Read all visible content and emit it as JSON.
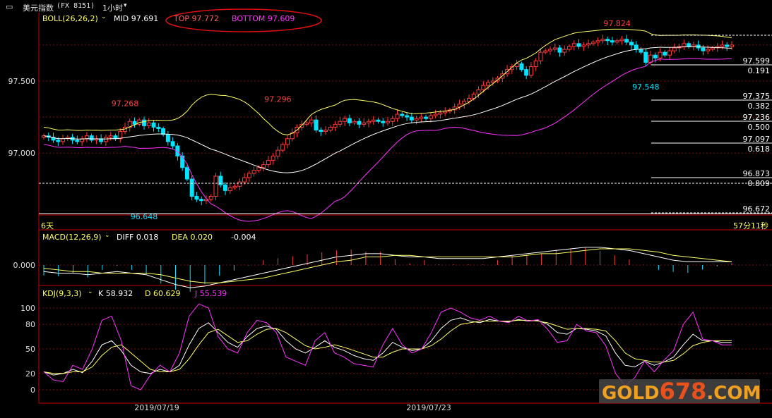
{
  "window": {
    "title": "美元指数",
    "code": "(FX 8151)",
    "period": "1小时"
  },
  "indicators": {
    "boll": {
      "name": "BOLL(26,26,2)",
      "mid_label": "MID",
      "mid": "97.691",
      "top_label": "TOP",
      "top": "97.772",
      "bottom_label": "BOTTOM",
      "bottom": "97.609"
    },
    "macd": {
      "name": "MACD(12,26,9)",
      "diff_label": "DIFF",
      "diff": "0.018",
      "dea_label": "DEA",
      "dea": "0.020",
      "macd": "-0.004"
    },
    "kdj": {
      "name": "KDJ(9,3,3)",
      "k_label": "K",
      "k": "58.932",
      "d_label": "D",
      "d": "60.629",
      "j_label": "J",
      "j": "55.539"
    }
  },
  "status": {
    "days": "6天",
    "countdown": "57分11秒"
  },
  "watermark": {
    "part1": "GOLD",
    "part2": "678",
    "part3": ".COM"
  },
  "colors": {
    "up": "#ff3c3c",
    "down": "#00e5ff",
    "top": "#ffff66",
    "mid": "#ffffff",
    "bottom": "#ff33ff",
    "grid": "#7a1010",
    "axis": "#cc0000",
    "annot_high": "#ff4040",
    "annot_low": "#00e5ff"
  },
  "chart_data": [
    {
      "type": "candlestick",
      "title": "美元指数 1小时",
      "y_ticks": [
        97.5,
        97.0
      ],
      "y_tick_labels": [
        "97.500",
        "97.000"
      ],
      "x_tick_labels": [
        "2019/07/19",
        "2019/07/23"
      ],
      "ylim": [
        96.6,
        97.95
      ],
      "annotations": [
        {
          "text": "97.268",
          "value": 97.268,
          "kind": "high",
          "index": 17
        },
        {
          "text": "96.648",
          "value": 96.648,
          "kind": "low",
          "index": 21
        },
        {
          "text": "97.296",
          "value": 97.296,
          "kind": "high",
          "index": 49
        },
        {
          "text": "97.824",
          "value": 97.824,
          "kind": "high",
          "index": 120
        },
        {
          "text": "97.548",
          "value": 97.548,
          "kind": "low",
          "index": 126
        }
      ],
      "fib_levels": [
        {
          "price": "97.599",
          "ratio": "0.191"
        },
        {
          "price": "97.375",
          "ratio": "0.382"
        },
        {
          "price": "97.236",
          "ratio": "0.500"
        },
        {
          "price": "97.097",
          "ratio": "0.618"
        },
        {
          "price": "96.873",
          "ratio": "0.809"
        },
        {
          "price": "96.672",
          "ratio": ""
        }
      ],
      "series_close": [
        97.12,
        97.11,
        97.09,
        97.08,
        97.1,
        97.11,
        97.09,
        97.08,
        97.1,
        97.12,
        97.09,
        97.1,
        97.08,
        97.11,
        97.12,
        97.1,
        97.15,
        97.18,
        97.22,
        97.2,
        97.23,
        97.19,
        97.21,
        97.18,
        97.17,
        97.13,
        97.08,
        97.05,
        96.98,
        96.9,
        96.82,
        96.7,
        96.68,
        96.67,
        96.68,
        96.7,
        96.84,
        96.78,
        96.74,
        96.76,
        96.77,
        96.8,
        96.83,
        96.86,
        96.88,
        96.9,
        96.92,
        96.95,
        96.98,
        97.02,
        97.06,
        97.1,
        97.14,
        97.18,
        97.2,
        97.21,
        97.23,
        97.16,
        97.15,
        97.16,
        97.18,
        97.2,
        97.22,
        97.24,
        97.21,
        97.22,
        97.2,
        97.21,
        97.22,
        97.23,
        97.22,
        97.21,
        97.22,
        97.24,
        97.27,
        97.26,
        97.25,
        97.23,
        97.24,
        97.25,
        97.24,
        97.26,
        97.27,
        97.28,
        97.29,
        97.3,
        97.32,
        97.34,
        97.36,
        97.38,
        97.41,
        97.44,
        97.47,
        97.49,
        97.5,
        97.52,
        97.55,
        97.58,
        97.6,
        97.62,
        97.58,
        97.54,
        97.6,
        97.64,
        97.7,
        97.71,
        97.72,
        97.73,
        97.7,
        97.72,
        97.74,
        97.76,
        97.74,
        97.75,
        97.76,
        97.77,
        97.78,
        97.79,
        97.78,
        97.77,
        97.78,
        97.79,
        97.77,
        97.75,
        97.72,
        97.7,
        97.63,
        97.68,
        97.66,
        97.7,
        97.68,
        97.71,
        97.73,
        97.74,
        97.76,
        97.74,
        97.75,
        97.73,
        97.71,
        97.72,
        97.73,
        97.74,
        97.75,
        97.74,
        97.75
      ]
    },
    {
      "type": "line",
      "title": "MACD(12,26,9)",
      "y_tick_labels": [
        "0.000"
      ],
      "series": [
        {
          "name": "DIFF",
          "values": [
            -0.04,
            -0.05,
            -0.05,
            -0.06,
            -0.05,
            -0.04,
            -0.05,
            -0.06,
            -0.09,
            -0.12,
            -0.14,
            -0.13,
            -0.11,
            -0.09,
            -0.07,
            -0.05,
            -0.03,
            -0.01,
            0.01,
            0.03,
            0.05,
            0.06,
            0.07,
            0.07,
            0.06,
            0.05,
            0.05,
            0.04,
            0.04,
            0.04,
            0.04,
            0.05,
            0.06,
            0.07,
            0.08,
            0.09,
            0.1,
            0.11,
            0.11,
            0.1,
            0.09,
            0.07,
            0.05,
            0.03,
            0.02,
            0.02,
            0.02,
            0.02
          ]
        },
        {
          "name": "DEA",
          "values": [
            -0.02,
            -0.03,
            -0.04,
            -0.04,
            -0.05,
            -0.05,
            -0.05,
            -0.05,
            -0.06,
            -0.08,
            -0.1,
            -0.11,
            -0.11,
            -0.1,
            -0.09,
            -0.08,
            -0.06,
            -0.04,
            -0.02,
            0.0,
            0.02,
            0.03,
            0.05,
            0.05,
            0.06,
            0.06,
            0.05,
            0.05,
            0.05,
            0.05,
            0.05,
            0.05,
            0.05,
            0.06,
            0.07,
            0.07,
            0.08,
            0.09,
            0.1,
            0.1,
            0.1,
            0.09,
            0.08,
            0.06,
            0.05,
            0.04,
            0.03,
            0.02
          ]
        }
      ]
    },
    {
      "type": "line",
      "title": "KDJ(9,3,3)",
      "y_ticks": [
        100,
        80,
        50,
        20,
        0
      ],
      "y_tick_labels": [
        "100",
        "80",
        "50",
        "20",
        "0"
      ],
      "series": [
        {
          "name": "K",
          "values": [
            22,
            18,
            20,
            25,
            21,
            35,
            55,
            60,
            48,
            30,
            22,
            20,
            25,
            22,
            30,
            55,
            75,
            82,
            70,
            58,
            52,
            65,
            75,
            78,
            74,
            60,
            50,
            45,
            52,
            60,
            52,
            48,
            42,
            38,
            36,
            45,
            58,
            52,
            48,
            50,
            60,
            75,
            85,
            88,
            84,
            82,
            86,
            84,
            83,
            86,
            84,
            85,
            80,
            70,
            68,
            75,
            74,
            72,
            66,
            45,
            30,
            28,
            35,
            30,
            34,
            40,
            55,
            68,
            60,
            60,
            58,
            58
          ]
        },
        {
          "name": "D",
          "values": [
            22,
            20,
            20,
            22,
            22,
            28,
            42,
            52,
            55,
            45,
            35,
            25,
            22,
            22,
            25,
            38,
            55,
            70,
            74,
            66,
            58,
            60,
            68,
            74,
            75,
            70,
            62,
            54,
            50,
            52,
            55,
            52,
            48,
            44,
            40,
            40,
            46,
            50,
            50,
            50,
            54,
            62,
            72,
            80,
            82,
            84,
            84,
            84,
            84,
            85,
            85,
            84,
            82,
            78,
            74,
            75,
            75,
            74,
            72,
            60,
            45,
            38,
            36,
            34,
            34,
            36,
            44,
            54,
            58,
            60,
            60,
            60
          ]
        },
        {
          "name": "J",
          "values": [
            22,
            12,
            10,
            30,
            25,
            50,
            85,
            90,
            60,
            5,
            0,
            18,
            30,
            22,
            45,
            90,
            105,
            100,
            65,
            50,
            45,
            70,
            85,
            82,
            70,
            40,
            35,
            30,
            60,
            70,
            45,
            40,
            32,
            30,
            28,
            55,
            75,
            55,
            45,
            50,
            70,
            95,
            100,
            95,
            88,
            85,
            90,
            84,
            82,
            90,
            84,
            86,
            74,
            58,
            60,
            80,
            72,
            70,
            54,
            20,
            5,
            15,
            35,
            22,
            36,
            48,
            80,
            95,
            62,
            60,
            55,
            55
          ]
        }
      ]
    }
  ]
}
